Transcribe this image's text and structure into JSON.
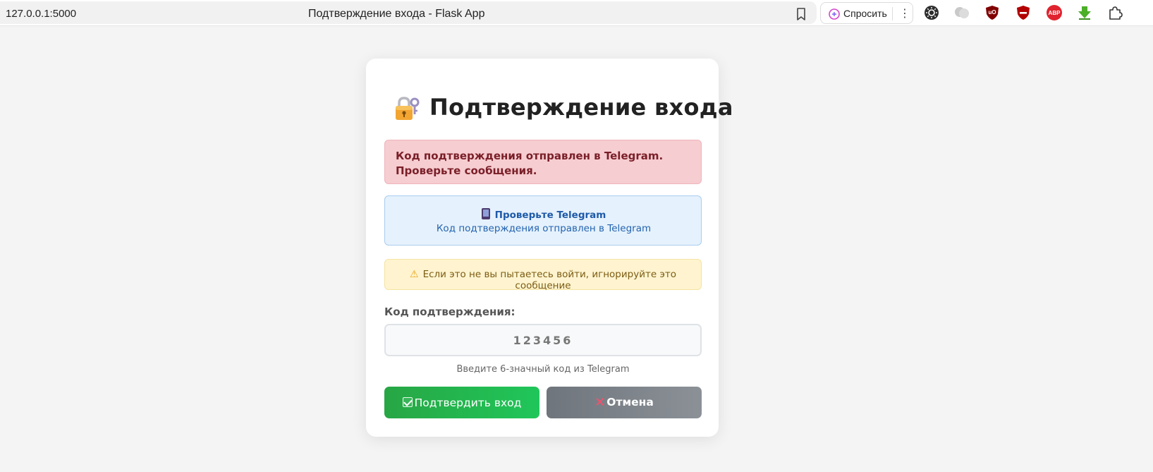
{
  "browser": {
    "url": "127.0.0.1:5000",
    "tab_title": "Подтверждение входа - Flask App",
    "ask_label": "Спросить",
    "extensions": [
      "sun-icon",
      "circles-icon",
      "ublock-icon",
      "shield-block-icon",
      "adblock-plus-icon",
      "download-arrow-icon",
      "puzzle-icon"
    ],
    "abp_text": "ABP",
    "ublock_text": "uO"
  },
  "card": {
    "title": "Подтверждение входа",
    "alert_text": "Код подтверждения отправлен в Telegram. Проверьте сообщения.",
    "info_heading": "Проверьте Telegram",
    "info_text": "Код подтверждения отправлен в Telegram",
    "warning_text": "Если это не вы пытаетесь войти, игнорируйте это сообщение",
    "code_label": "Код подтверждения:",
    "code_placeholder": "123456",
    "code_hint": "Введите 6-значный код из Telegram",
    "confirm_label": "Подтвердить вход",
    "cancel_label": "Отмена"
  },
  "colors": {
    "confirm_button": "#22b14c",
    "cancel_button": "#7a8087",
    "alert_bg": "#f6cdd1",
    "info_bg": "#e5f1fc",
    "warning_bg": "#fff4cf"
  }
}
